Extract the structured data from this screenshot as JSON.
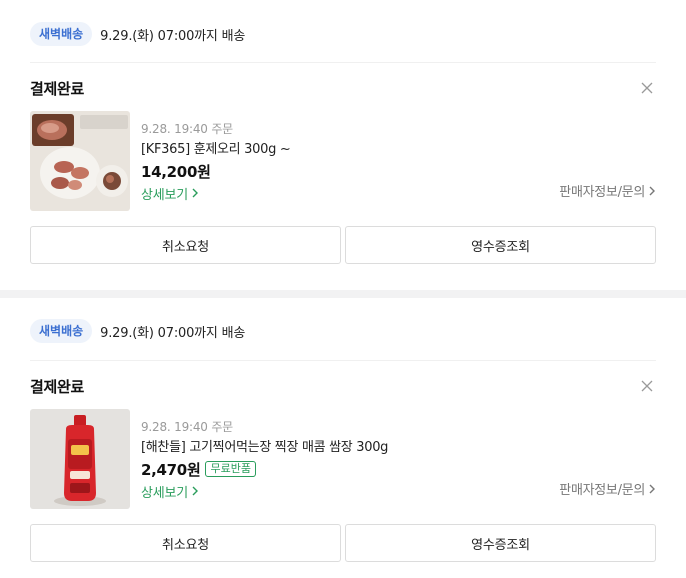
{
  "orders": [
    {
      "delivery_badge": "새벽배송",
      "delivery_text": "9.29.(화) 07:00까지 배송",
      "status": "결제완료",
      "order_date": "9.28. 19:40 주문",
      "product_name": "[KF365] 훈제오리 300g ~",
      "price": "14,200원",
      "free_return": "",
      "detail_link": "상세보기",
      "seller_link": "판매자정보/문의",
      "cancel_button": "취소요청",
      "receipt_button": "영수증조회",
      "thumbnail": "smoked-duck-image"
    },
    {
      "delivery_badge": "새벽배송",
      "delivery_text": "9.29.(화) 07:00까지 배송",
      "status": "결제완료",
      "order_date": "9.28. 19:40 주문",
      "product_name": "[해찬들] 고기찍어먹는장 찍장 매콤 쌈장 300g",
      "price": "2,470원",
      "free_return": "무료반품",
      "detail_link": "상세보기",
      "seller_link": "판매자정보/문의",
      "cancel_button": "취소요청",
      "receipt_button": "영수증조회",
      "thumbnail": "ssamjang-bottle-image"
    }
  ],
  "colors": {
    "badge_bg": "#eef3fb",
    "badge_text": "#3b6fd1",
    "accent_green": "#2a9d5c",
    "section_gap": "#f2f2f3"
  }
}
